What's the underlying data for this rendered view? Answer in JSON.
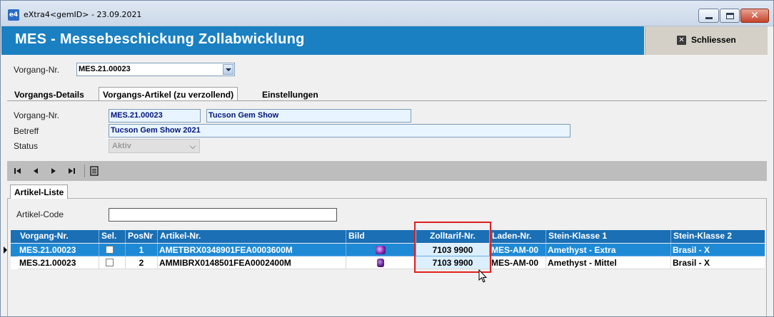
{
  "window": {
    "title": "eXtra4<gemID>  -  23.09.2021",
    "app_icon_text": "e4"
  },
  "header": {
    "title": "MES - Messebeschickung Zollabwicklung",
    "close_label": "Schliessen",
    "accent_color": "#1a80c2"
  },
  "selector": {
    "label": "Vorgang-Nr.",
    "value": "MES.21.00023"
  },
  "tabs": [
    {
      "label": "Vorgangs-Details",
      "active": false
    },
    {
      "label": "Vorgangs-Artikel (zu verzollend)",
      "active": true
    },
    {
      "label": "Einstellungen",
      "active": false
    }
  ],
  "details": {
    "vorgang_label": "Vorgang-Nr.",
    "vorgang_value": "MES.21.00023",
    "vorgang_name": "Tucson Gem Show",
    "betreff_label": "Betreff",
    "betreff_value": "Tucson Gem Show 2021",
    "status_label": "Status",
    "status_value": "Aktiv"
  },
  "navigation": {
    "icons": [
      "first-record-icon",
      "previous-record-icon",
      "next-record-icon",
      "last-record-icon",
      "list-view-icon"
    ]
  },
  "sub_tab": {
    "label": "Artikel-Liste"
  },
  "filter": {
    "label": "Artikel-Code",
    "value": ""
  },
  "grid": {
    "columns": [
      "Vorgang-Nr.",
      "Sel.",
      "PosNr",
      "Artikel-Nr.",
      "Bild",
      "Zolltarif-Nr.",
      "Laden-Nr.",
      "Stein-Klasse 1",
      "Stein-Klasse 2"
    ],
    "rows": [
      {
        "vorgang": "MES.21.00023",
        "sel": false,
        "posnr": "1",
        "artikel": "AMETBRX0348901FEA0003600M",
        "bild": "amethyst-gem-image",
        "zoll": "7103 9900",
        "laden": "MES-AM-00",
        "klasse1": "Amethyst - Extra",
        "klasse2": "Brasil - X",
        "selected": true
      },
      {
        "vorgang": "MES.21.00023",
        "sel": false,
        "posnr": "2",
        "artikel": "AMMIBRX0148501FEA0002400M",
        "bild": "amethyst-gem-image",
        "zoll": "7103 9900",
        "laden": "MES-AM-00",
        "klasse1": "Amethyst - Mittel",
        "klasse2": "Brasil - X",
        "selected": false
      }
    ]
  }
}
